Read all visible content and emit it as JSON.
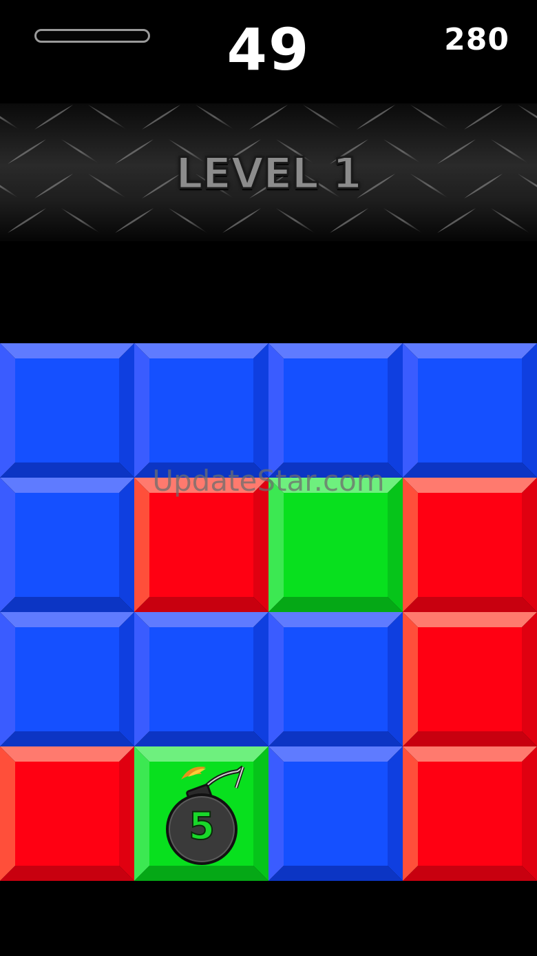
{
  "hud": {
    "progress": 0,
    "timer": "49",
    "score": "280"
  },
  "banner": {
    "level_label": "LEVEL 1"
  },
  "watermark": "UpdateStar.com",
  "colors": {
    "blue": "#1550ff",
    "red": "#ff0012",
    "green": "#08e01e"
  },
  "board": {
    "rows": [
      [
        "blue",
        "blue",
        "blue",
        "blue"
      ],
      [
        "blue",
        "red",
        "green",
        "red"
      ],
      [
        "blue",
        "blue",
        "blue",
        "red"
      ],
      [
        "red",
        "green",
        "blue",
        "red"
      ]
    ],
    "bomb": {
      "row": 3,
      "col": 1,
      "icon": "bomb-icon",
      "count": "5"
    }
  }
}
